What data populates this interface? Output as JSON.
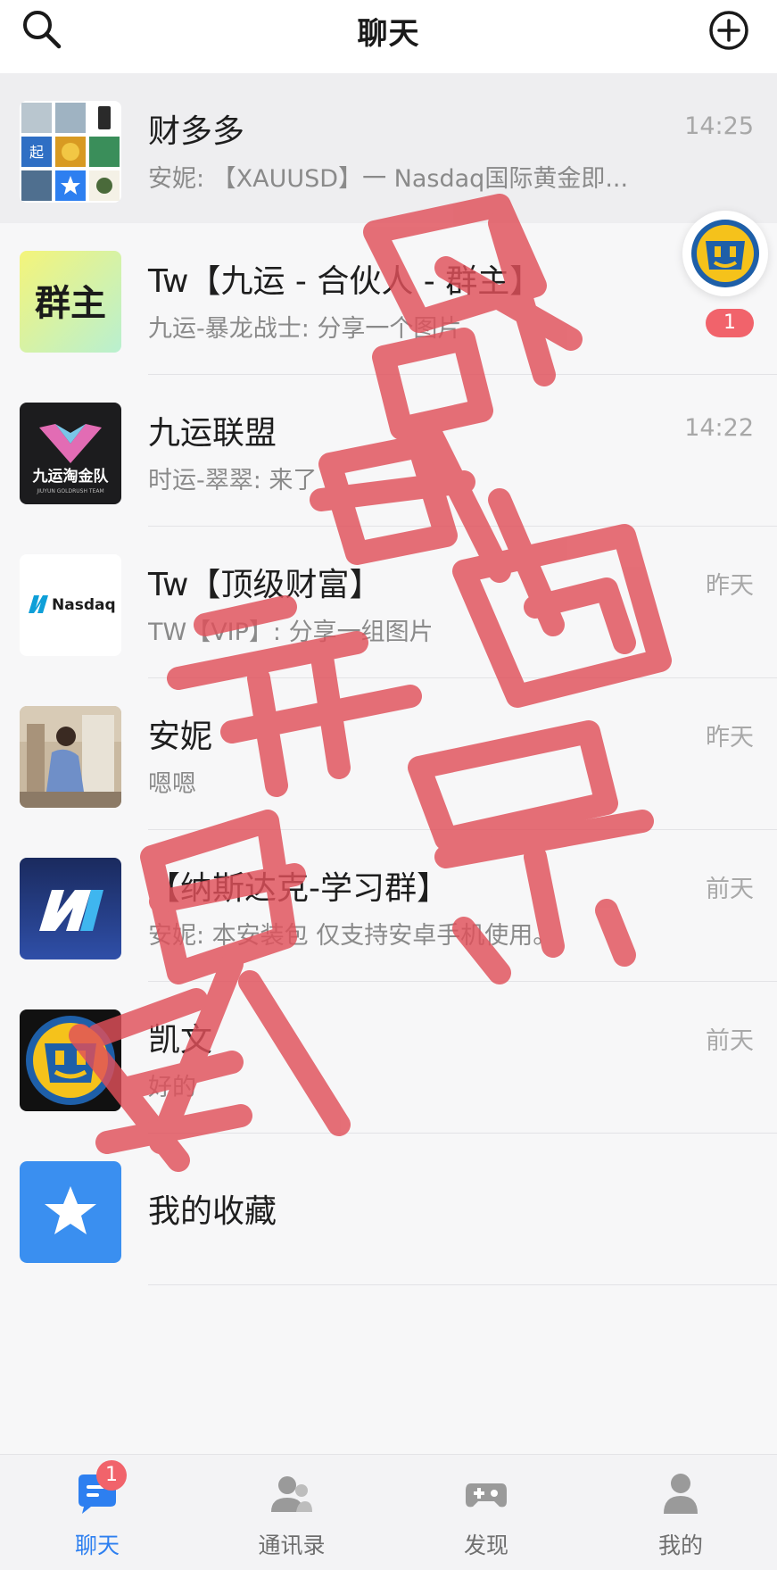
{
  "header": {
    "title": "聊天"
  },
  "chats": [
    {
      "name": "财多多",
      "preview": "安妮: 【XAUUSD】一 Nasdaq国际黄金即...",
      "time": "14:25"
    },
    {
      "name": "Tw【九运 - 合伙人 - 群主】",
      "preview": "九运-暴龙战士: 分享一个图片",
      "time": "",
      "unread": "1",
      "avatar_text": "群主"
    },
    {
      "name": "九运联盟",
      "preview": "时运-翠翠: 来了",
      "time": "14:22",
      "avatar_text": "九运淘金队",
      "avatar_subtext": "JIUYUN GOLDRUSH TEAM"
    },
    {
      "name": "Tw【顶级财富】",
      "preview": "TW【VIP】: 分享一组图片",
      "time": "昨天",
      "avatar_text": "Nasdaq"
    },
    {
      "name": "安妮",
      "preview": "嗯嗯",
      "time": "昨天"
    },
    {
      "name": "【纳斯达克-学习群】",
      "preview": "安妮: 本安装包 仅支持安卓手机使用。",
      "time": "前天"
    },
    {
      "name": "凯文",
      "preview": "好的",
      "time": "前天"
    },
    {
      "name": "我的收藏",
      "preview": "",
      "time": ""
    }
  ],
  "grid_avatar_label": "起",
  "tabbar": {
    "items": [
      {
        "label": "聊天",
        "badge": "1"
      },
      {
        "label": "通讯录"
      },
      {
        "label": "发现"
      },
      {
        "label": "我的"
      }
    ]
  },
  "colors": {
    "accent": "#2d7ff0",
    "badge": "#f1636b",
    "watermark": "#e0505a"
  }
}
